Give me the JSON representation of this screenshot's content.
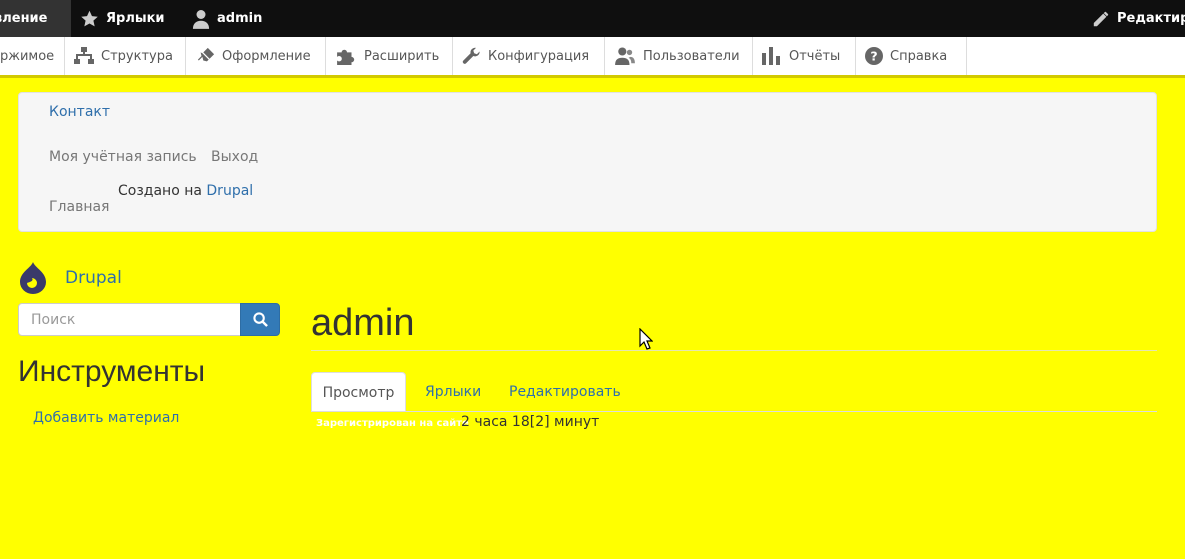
{
  "toolbar": {
    "manage": "вление",
    "shortcuts": "Ярлыки",
    "user": "admin",
    "edit": "Редактир"
  },
  "tray": {
    "items": [
      {
        "label": "ржимое",
        "icon": "none"
      },
      {
        "label": "Структура",
        "icon": "sitemap-icon"
      },
      {
        "label": "Оформление",
        "icon": "brush-icon"
      },
      {
        "label": "Расширить",
        "icon": "puzzle-icon"
      },
      {
        "label": "Конфигурация",
        "icon": "wrench-icon"
      },
      {
        "label": "Пользователи",
        "icon": "users-icon"
      },
      {
        "label": "Отчёты",
        "icon": "bar-chart-icon"
      },
      {
        "label": "Справка",
        "icon": "help-icon"
      }
    ]
  },
  "panel": {
    "contact": "Контакт",
    "account": "Моя учётная запись",
    "logout": "Выход",
    "home": "Главная",
    "powered_prefix": "Создано на",
    "powered_link": "Drupal"
  },
  "site": {
    "name": "Drupal"
  },
  "search": {
    "placeholder": "Поиск"
  },
  "sidebar": {
    "heading": "Инструменты",
    "add_content": "Добавить материал"
  },
  "page": {
    "title": "admin"
  },
  "tabs": {
    "view": "Просмотр",
    "shortcuts": "Ярлыки",
    "edit": "Редактировать"
  },
  "member": {
    "label": "Зарегистрирован на сайте",
    "value": "2 часа 18[2] минут"
  },
  "colors": {
    "background": "#ffff00",
    "link": "#2f6fab",
    "toolbar": "#0f0f0f",
    "search_button": "#337ab7"
  }
}
